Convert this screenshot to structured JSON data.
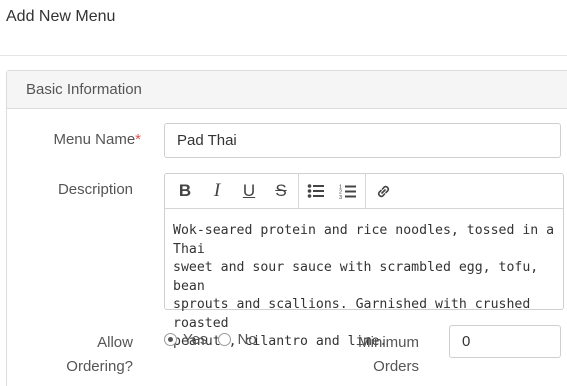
{
  "page": {
    "title": "Add New Menu"
  },
  "panel": {
    "header": "Basic Information"
  },
  "form": {
    "menu_name": {
      "label": "Menu Name",
      "required_mark": "*",
      "value": "Pad Thai"
    },
    "description": {
      "label": "Description",
      "toolbar": {
        "bold": "B",
        "italic": "I",
        "underline": "U",
        "strikethrough": "S",
        "icons": [
          "bullet-list-icon",
          "numbered-list-icon",
          "link-icon"
        ]
      },
      "lines": [
        "Wok-seared protein and rice noodles, tossed in a Thai",
        "sweet and sour sauce with scrambled egg, tofu, bean",
        "sprouts and scallions. Garnished with crushed roasted",
        "peanuts, cilantro and lime."
      ]
    },
    "allow_ordering": {
      "label_line1": "Allow",
      "label_line2": "Ordering?",
      "options": [
        "Yes",
        "No"
      ],
      "selected": "Yes"
    },
    "minimum_orders": {
      "label_line1": "Minimum",
      "label_line2": "Orders",
      "value": "0"
    }
  },
  "colors": {
    "required": "#d9534f",
    "panel_header_bg": "#f5f5f5",
    "border": "#dcdcdc"
  }
}
